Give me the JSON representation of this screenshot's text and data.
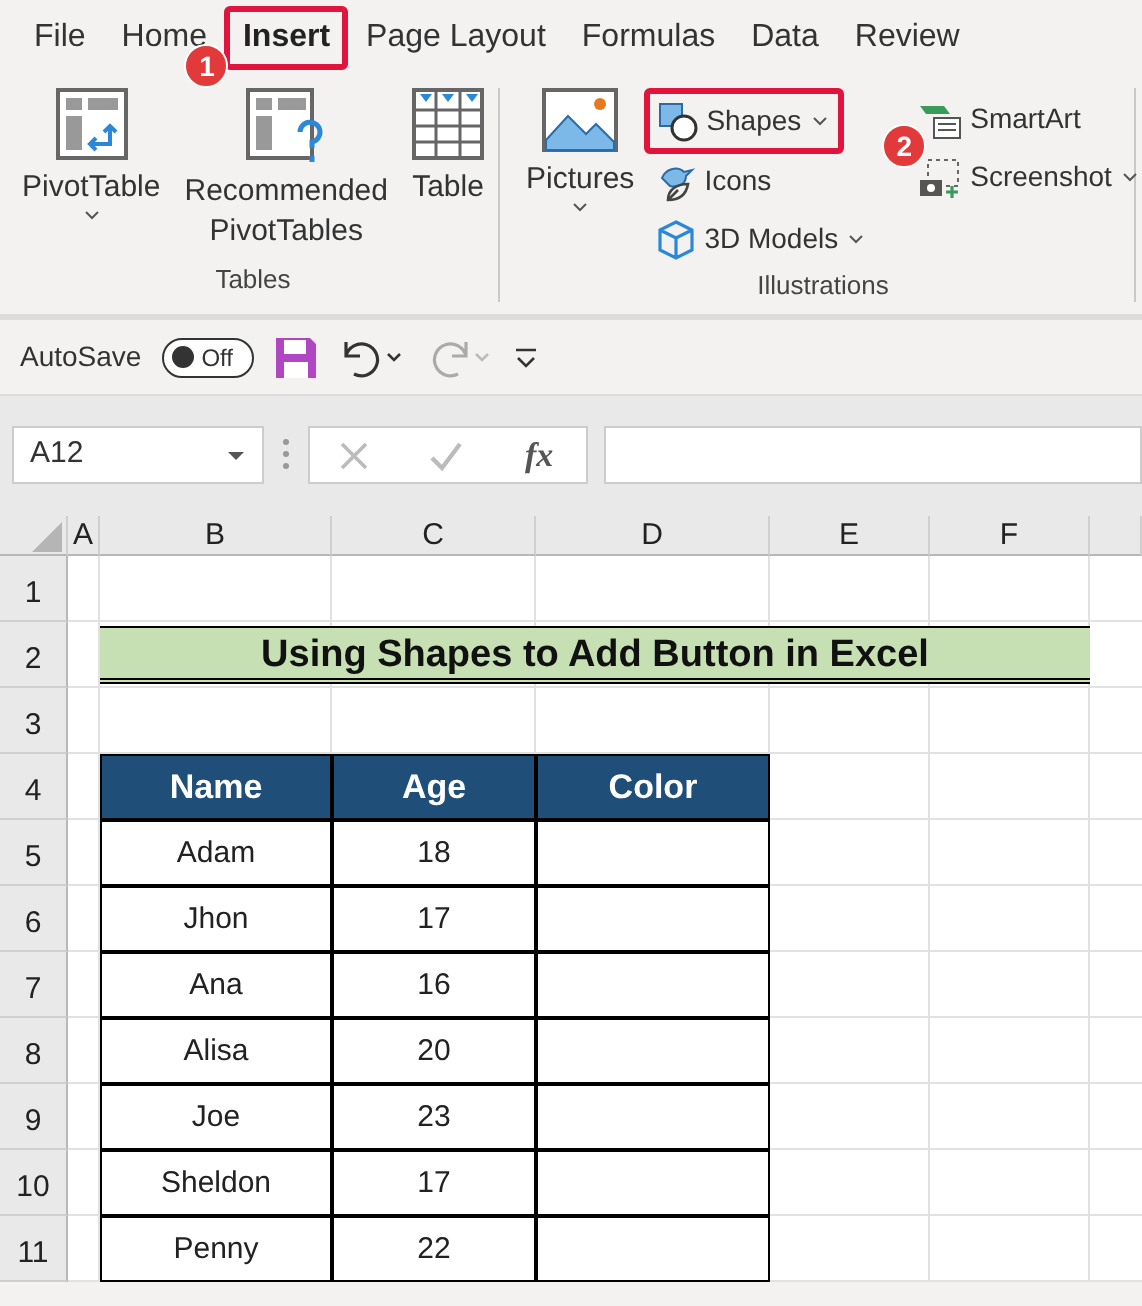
{
  "tabs": [
    {
      "label": "File",
      "selected": false
    },
    {
      "label": "Home",
      "selected": false
    },
    {
      "label": "Insert",
      "selected": true,
      "highlighted": true,
      "callout": "1"
    },
    {
      "label": "Page Layout",
      "selected": false
    },
    {
      "label": "Formulas",
      "selected": false
    },
    {
      "label": "Data",
      "selected": false
    },
    {
      "label": "Review",
      "selected": false
    }
  ],
  "ribbon": {
    "groups": [
      {
        "label": "Tables",
        "items": [
          {
            "kind": "large",
            "label": "PivotTable",
            "dropdown": true
          },
          {
            "kind": "large",
            "label": "Recommended PivotTables"
          },
          {
            "kind": "large",
            "label": "Table"
          }
        ]
      },
      {
        "label": "Illustrations",
        "items": [
          {
            "kind": "large",
            "label": "Pictures",
            "dropdown": true
          },
          {
            "kind": "stack",
            "buttons": [
              {
                "label": "Shapes",
                "dropdown": true,
                "highlighted": true,
                "callout": "2"
              },
              {
                "label": "Icons"
              },
              {
                "label": "3D Models",
                "dropdown": true
              }
            ]
          },
          {
            "kind": "stack",
            "buttons": [
              {
                "label": "SmartArt"
              },
              {
                "label": "Screenshot",
                "dropdown": true
              }
            ]
          }
        ]
      }
    ]
  },
  "quick_access": {
    "autosave_label": "AutoSave",
    "autosave_on": false,
    "toggle_text": "Off"
  },
  "formula_bar": {
    "name_box": "A12",
    "function_label": "fx"
  },
  "sheet": {
    "columns": [
      "A",
      "B",
      "C",
      "D",
      "E",
      "F"
    ],
    "rows": [
      "1",
      "2",
      "3",
      "4",
      "5",
      "6",
      "7",
      "8",
      "9",
      "10",
      "11"
    ],
    "title": "Using Shapes to Add Button in Excel",
    "table": {
      "columns": [
        "Name",
        "Age",
        "Color"
      ],
      "rows": [
        {
          "name": "Adam",
          "age": "18"
        },
        {
          "name": "Jhon",
          "age": "17"
        },
        {
          "name": "Ana",
          "age": "16"
        },
        {
          "name": "Alisa",
          "age": "20"
        },
        {
          "name": "Joe",
          "age": "23"
        },
        {
          "name": "Sheldon",
          "age": "17"
        },
        {
          "name": "Penny",
          "age": "22"
        }
      ]
    }
  }
}
